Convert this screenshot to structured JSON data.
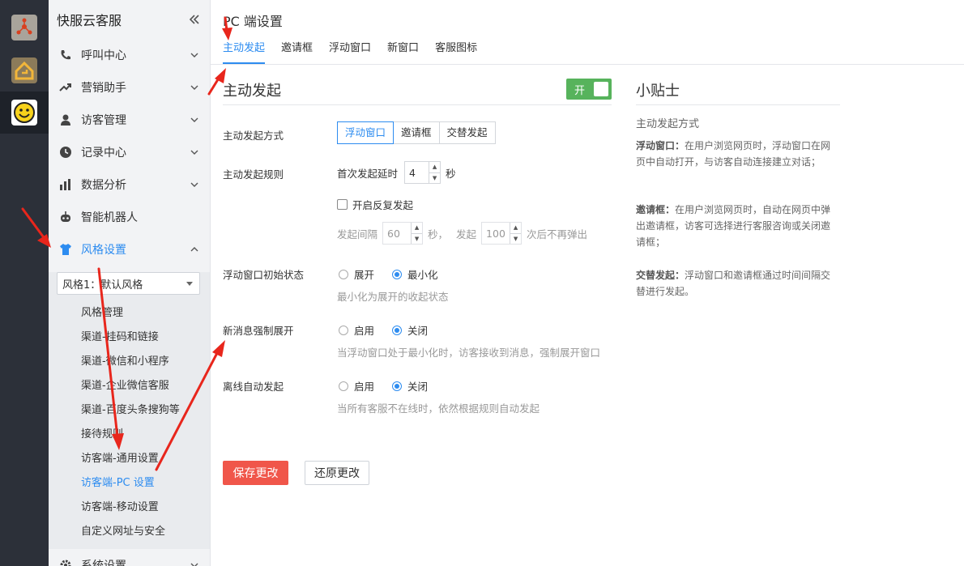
{
  "sidebar": {
    "title": "快服云客服",
    "menu": [
      {
        "label": "呼叫中心",
        "icon": "phone-icon"
      },
      {
        "label": "营销助手",
        "icon": "trend-icon"
      },
      {
        "label": "访客管理",
        "icon": "user-icon"
      },
      {
        "label": "记录中心",
        "icon": "clock-icon"
      },
      {
        "label": "数据分析",
        "icon": "bar-chart-icon"
      },
      {
        "label": "智能机器人",
        "icon": "robot-icon"
      },
      {
        "label": "风格设置",
        "icon": "shirt-icon"
      }
    ],
    "style_select": "风格1：默认风格",
    "sub_items": [
      "风格管理",
      "渠道-挂码和链接",
      "渠道-微信和小程序",
      "渠道-企业微信客服",
      "渠道-百度头条搜狗等",
      "接待规则",
      "访客端-通用设置",
      "访客端-PC 设置",
      "访客端-移动设置",
      "自定义网址与安全"
    ],
    "bottom_item": "系统设置"
  },
  "page": {
    "title": "PC 端设置",
    "tabs": [
      "主动发起",
      "邀请框",
      "浮动窗口",
      "新窗口",
      "客服图标"
    ]
  },
  "form": {
    "section_title": "主动发起",
    "toggle_label": "开",
    "mode_label": "主动发起方式",
    "modes": [
      "浮动窗口",
      "邀请框",
      "交替发起"
    ],
    "rule_label": "主动发起规则",
    "first_delay_label": "首次发起延时",
    "first_delay_value": "4",
    "sec": "秒",
    "repeat_label": "开启反复发起",
    "interval_label": "发起间隔",
    "interval_value": "60",
    "sec_comma": "秒，",
    "launch": "发起",
    "max_value": "100",
    "max_suffix": "次后不再弹出",
    "float_state_label": "浮动窗口初始状态",
    "expand": "展开",
    "minimize": "最小化",
    "float_hint": "最小化为展开的收起状态",
    "force_label": "新消息强制展开",
    "enable": "启用",
    "disable": "关闭",
    "force_hint": "当浮动窗口处于最小化时，访客接收到消息，强制展开窗口",
    "offline_label": "离线自动发起",
    "offline_hint": "当所有客服不在线时，依然根据规则自动发起",
    "save": "保存更改",
    "reset": "还原更改"
  },
  "tips": {
    "title": "小贴士",
    "subtitle": "主动发起方式",
    "items": [
      {
        "term": "浮动窗口：",
        "text": "在用户浏览网页时，浮动窗口在网页中自动打开，与访客自动连接建立对话；"
      },
      {
        "term": "邀请框：",
        "text": "在用户浏览网页时，自动在网页中弹出邀请框，访客可选择进行客服咨询或关闭邀请框；"
      },
      {
        "term": "交替发起：",
        "text": "浮动窗口和邀请框通过时间间隔交替进行发起。"
      }
    ]
  },
  "colors": {
    "accent": "#2d8cf0",
    "toggle_on": "#57b35c",
    "save_button": "#f0564a",
    "annotation": "#e8261c",
    "rail": "#2c3039"
  }
}
